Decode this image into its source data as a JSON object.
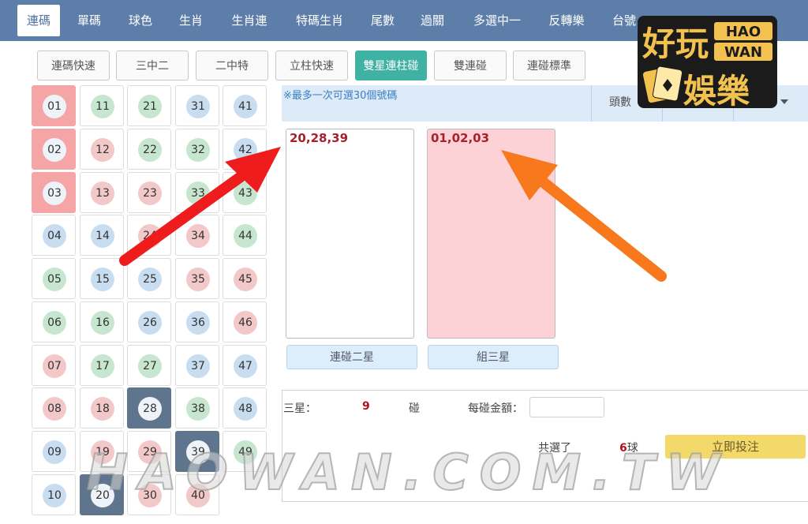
{
  "nav": {
    "items": [
      "連碼",
      "單碼",
      "球色",
      "生肖",
      "生肖連",
      "特碼生肖",
      "尾數",
      "過關",
      "多選中一",
      "反轉樂",
      "台號"
    ],
    "active_index": 0
  },
  "subtabs": {
    "items": [
      "連碼快速",
      "三中二",
      "二中特",
      "立柱快速",
      "雙星連柱碰",
      "雙連碰",
      "連碰標準"
    ],
    "active_index": 4
  },
  "grid": {
    "numbers": [
      "01",
      "02",
      "03",
      "04",
      "05",
      "06",
      "07",
      "08",
      "09",
      "10",
      "11",
      "12",
      "13",
      "14",
      "15",
      "16",
      "17",
      "18",
      "19",
      "20",
      "21",
      "22",
      "23",
      "24",
      "25",
      "26",
      "27",
      "28",
      "29",
      "30",
      "31",
      "32",
      "33",
      "34",
      "35",
      "36",
      "37",
      "38",
      "39",
      "40",
      "41",
      "42",
      "43",
      "44",
      "45",
      "46",
      "47",
      "48",
      "49"
    ],
    "colors": [
      "red",
      "red",
      "blue",
      "blue",
      "green",
      "green",
      "red",
      "red",
      "blue",
      "blue",
      "green",
      "red",
      "red",
      "blue",
      "blue",
      "green",
      "green",
      "red",
      "red",
      "blue",
      "green",
      "green",
      "red",
      "red",
      "blue",
      "blue",
      "green",
      "green",
      "red",
      "red",
      "blue",
      "green",
      "green",
      "red",
      "red",
      "blue",
      "blue",
      "green",
      "green",
      "red",
      "blue",
      "blue",
      "green",
      "green",
      "red",
      "red",
      "blue",
      "blue",
      "green"
    ],
    "selected_pink": [
      "01",
      "02",
      "03"
    ],
    "selected_blue": [
      "20",
      "28",
      "39"
    ]
  },
  "panel": {
    "notice": "※最多一次可選30個號碼",
    "head_label": "頭數",
    "box1_text": "20,28,39",
    "box1_button": "連碰二星",
    "box2_text": "01,02,03",
    "box2_button": "組三星",
    "box1_color": "#ffffff",
    "box2_color": "#fdd2d7"
  },
  "summary": {
    "stars_label": "三星：",
    "stars_count": "9",
    "peng_label": "碰",
    "amount_label": "每碰金額：",
    "amount_value": "",
    "total_label": "共選了",
    "total_count": "6",
    "total_unit": "球",
    "submit_label": "立即投注"
  },
  "overlay": {
    "logo_cn_1": "好玩",
    "logo_cn_2": "娛樂",
    "logo_en_1": "HAO",
    "logo_en_2": "WAN",
    "watermark": "HAOWAN.COM.TW",
    "arrow_red_color": "#ee1c1c",
    "arrow_orange_color": "#f7781d"
  }
}
